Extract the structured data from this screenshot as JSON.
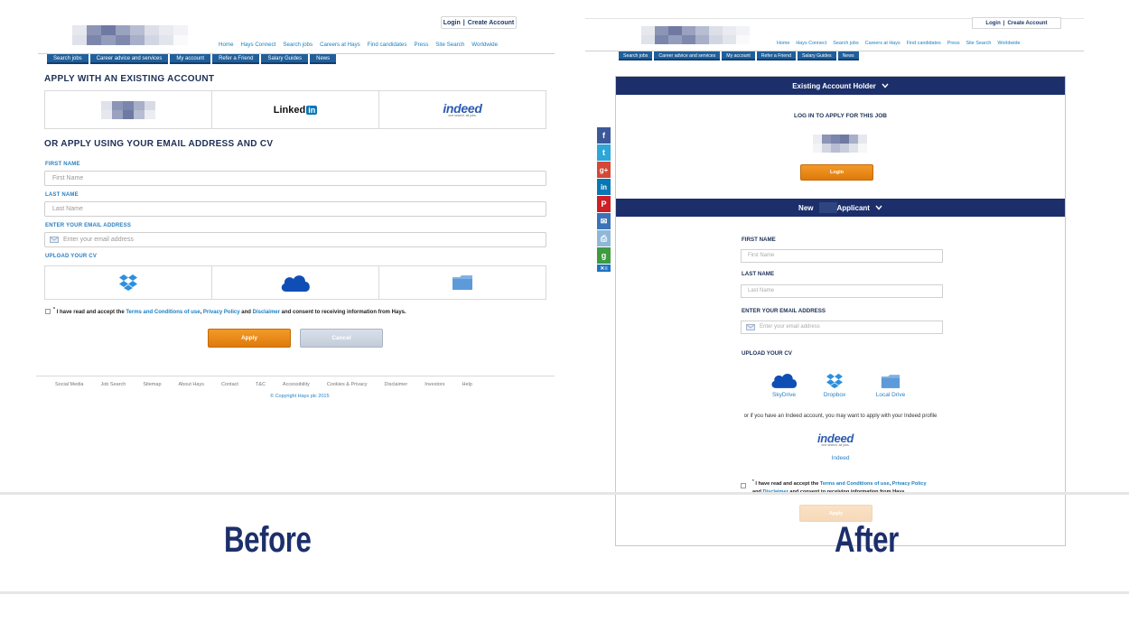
{
  "before": {
    "header": {
      "login": "Login",
      "separator": "|",
      "create_account": "Create Account",
      "nav": [
        "Home",
        "Hays Connect",
        "Search jobs",
        "Careers at Hays",
        "Find candidates",
        "Press",
        "Site Search",
        "Worldwide"
      ],
      "tabs": [
        "Search jobs",
        "Career advice and services",
        "My account",
        "Refer a Friend",
        "Salary Guides",
        "News"
      ]
    },
    "existing_heading": "APPLY WITH AN EXISTING ACCOUNT",
    "providers": {
      "linkedin_text": "Linked",
      "linkedin_in": "in",
      "indeed_word": "indeed",
      "indeed_tagline": "one search. all jobs."
    },
    "email_heading": "OR APPLY USING YOUR EMAIL ADDRESS AND CV",
    "first_name": {
      "label": "FIRST NAME",
      "placeholder": "First Name"
    },
    "last_name": {
      "label": "LAST NAME",
      "placeholder": "Last Name"
    },
    "email": {
      "label": "ENTER YOUR EMAIL ADDRESS",
      "placeholder": "Enter your email address"
    },
    "upload_label": "UPLOAD YOUR CV",
    "terms": {
      "asterisk": "*",
      "prefix": "I have read and accept the",
      "terms_link": "Terms and Conditions of use",
      "comma": ",",
      "privacy_link": "Privacy Policy",
      "and": "and",
      "disclaimer_link": "Disclaimer",
      "suffix": "and consent to receiving information from Hays."
    },
    "apply": "Apply",
    "cancel": "Cancel",
    "footer": [
      "Social Media",
      "Job Search",
      "Sitemap",
      "About Hays",
      "Contact",
      "T&C",
      "Accessibility",
      "Cookies & Privacy",
      "Disclaimer",
      "Investors",
      "Help"
    ],
    "copyright": "© Copyright Hays plc 2015"
  },
  "after": {
    "header": {
      "login": "Login",
      "separator": "|",
      "create_account": "Create Account",
      "nav": [
        "Home",
        "Hays Connect",
        "Search jobs",
        "Careers at Hays",
        "Find candidates",
        "Press",
        "Site Search",
        "Worldwide"
      ],
      "tabs": [
        "Search jobs",
        "Career advice and services",
        "My account",
        "Refer a Friend",
        "Salary Guides",
        "News"
      ]
    },
    "existing_bar": "Existing Account Holder",
    "login_title": "LOG IN TO APPLY FOR THIS JOB",
    "login_button": "Login",
    "new_bar_prefix": "New",
    "new_bar_suffix": "Applicant",
    "first_name": {
      "label": "FIRST NAME",
      "placeholder": "First Name"
    },
    "last_name": {
      "label": "LAST NAME",
      "placeholder": "Last Name"
    },
    "email": {
      "label": "ENTER YOUR EMAIL ADDRESS",
      "placeholder": "Enter your email address"
    },
    "upload_label": "UPLOAD YOUR CV",
    "cv_options": [
      {
        "label": "SkyDrive",
        "icon": "cloud-icon"
      },
      {
        "label": "Dropbox",
        "icon": "dropbox-icon"
      },
      {
        "label": "Local Drive",
        "icon": "folder-icon"
      }
    ],
    "indeed_note": "or if you have an Indeed account, you may want to apply with your Indeed profile",
    "indeed_word": "indeed",
    "indeed_tagline": "one search. all jobs.",
    "indeed_label": "Indeed",
    "terms": {
      "asterisk": "*",
      "prefix": "I have read and accept the",
      "terms_link": "Terms and Conditions of use",
      "comma": ",",
      "privacy_link": "Privacy Policy",
      "and": "and",
      "disclaimer_link": "Disclaimer",
      "suffix": "and consent to receiving information from Hays."
    },
    "apply": "Apply",
    "social": [
      {
        "glyph": "f",
        "color": "#3b5998",
        "icon": "facebook-icon"
      },
      {
        "glyph": "t",
        "color": "#2ea6d8",
        "icon": "twitter-icon"
      },
      {
        "glyph": "g+",
        "color": "#d34836",
        "icon": "google-plus-icon"
      },
      {
        "glyph": "in",
        "color": "#0a77b5",
        "icon": "linkedin-icon"
      },
      {
        "glyph": "P",
        "color": "#cb2027",
        "icon": "pinterest-icon"
      },
      {
        "glyph": "✉",
        "color": "#3b73b9",
        "icon": "email-icon"
      },
      {
        "glyph": "⎙",
        "color": "#8fb7d8",
        "icon": "print-icon"
      },
      {
        "glyph": "g",
        "color": "#3f9b3f",
        "icon": "share-icon"
      },
      {
        "glyph": "✕≡",
        "color": "#1e74c2",
        "icon": "more-icon"
      }
    ]
  },
  "captions": {
    "before": "Before",
    "after": "After"
  },
  "colors": {
    "navy": "#1c2f6b",
    "tab_blue": "#1f5f9b",
    "orange": "#ea8a17",
    "link": "#2a7fc0"
  }
}
